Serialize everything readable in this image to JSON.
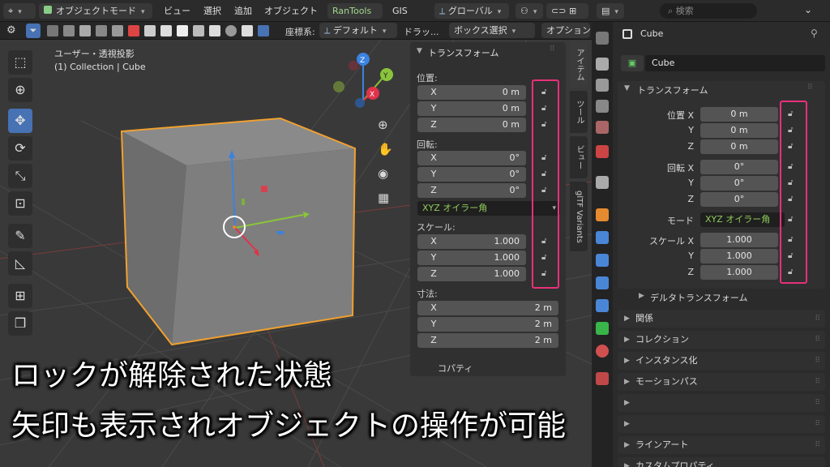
{
  "header": {
    "mode": "オブジェクトモード",
    "menus": [
      "ビュー",
      "選択",
      "追加",
      "オブジェクト"
    ],
    "addon1": "RanTools",
    "addon2": "GIS",
    "transform_orientation": "グローバル",
    "search_placeholder": "検索"
  },
  "header2": {
    "coord_label": "座標系:",
    "coord_value": "デフォルト",
    "drag_label": "ドラッ...",
    "select_mode": "ボックス選択",
    "options": "オプション"
  },
  "viewport": {
    "view_name": "ユーザー・透視投影",
    "collection_info": "(1) Collection | Cube",
    "gizmo_axes": [
      "X",
      "Y",
      "Z"
    ]
  },
  "npanel": {
    "tabs": [
      "アイテム",
      "ツール",
      "ビュー",
      "glTF Variants"
    ],
    "section_title": "トランスフォーム",
    "location_label": "位置:",
    "location": [
      {
        "axis": "X",
        "value": "0 m"
      },
      {
        "axis": "Y",
        "value": "0 m"
      },
      {
        "axis": "Z",
        "value": "0 m"
      }
    ],
    "rotation_label": "回転:",
    "rotation": [
      {
        "axis": "X",
        "value": "0°"
      },
      {
        "axis": "Y",
        "value": "0°"
      },
      {
        "axis": "Z",
        "value": "0°"
      }
    ],
    "rotation_mode": "XYZ オイラー角",
    "scale_label": "スケール:",
    "scale": [
      {
        "axis": "X",
        "value": "1.000"
      },
      {
        "axis": "Y",
        "value": "1.000"
      },
      {
        "axis": "Z",
        "value": "1.000"
      }
    ],
    "dimensions_label": "寸法:",
    "dimensions": [
      {
        "axis": "X",
        "value": "2 m"
      },
      {
        "axis": "Y",
        "value": "2 m"
      },
      {
        "axis": "Z",
        "value": "2 m"
      }
    ],
    "props_partial": "コパティ"
  },
  "properties": {
    "object_name_header": "Cube",
    "object_name_field": "Cube",
    "transform_title": "トランスフォーム",
    "location_label": "位置 X",
    "location": [
      {
        "axis": "X",
        "value": "0 m"
      },
      {
        "axis": "Y",
        "value": "0 m"
      },
      {
        "axis": "Z",
        "value": "0 m"
      }
    ],
    "rotation_label": "回転 X",
    "rotation": [
      {
        "axis": "X",
        "value": "0°"
      },
      {
        "axis": "Y",
        "value": "0°"
      },
      {
        "axis": "Z",
        "value": "0°"
      }
    ],
    "mode_label": "モード",
    "mode_value": "XYZ オイラー角",
    "scale_label": "スケール X",
    "scale": [
      {
        "axis": "X",
        "value": "1.000"
      },
      {
        "axis": "Y",
        "value": "1.000"
      },
      {
        "axis": "Z",
        "value": "1.000"
      }
    ],
    "delta_transform": "デルタトランスフォーム",
    "sections": [
      "関係",
      "コレクション",
      "インスタンス化",
      "モーションパス",
      "",
      "",
      "ラインアート",
      "カスタムプロパティ"
    ]
  },
  "subtitles": {
    "line1": "ロックが解除された状態",
    "line2": "矢印も表示されオブジェクトの操作が可能"
  },
  "colors": {
    "accent": "#4772b3",
    "highlight_box": "#e8307a",
    "selection_outline": "#f0a030",
    "axis_x": "#e0334a",
    "axis_y": "#8ac43a",
    "axis_z": "#3c82e0"
  }
}
